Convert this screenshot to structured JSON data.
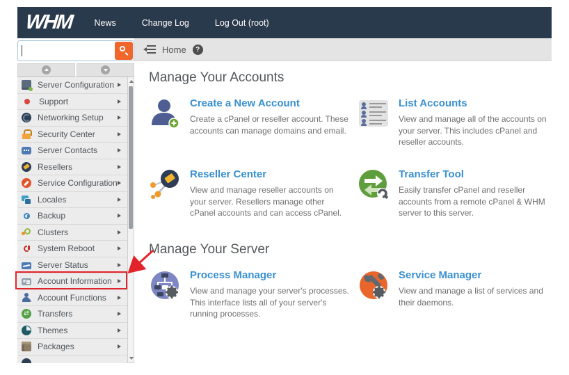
{
  "topbar": {
    "logo_text": "WHM",
    "links": [
      {
        "label": "News"
      },
      {
        "label": "Change Log"
      },
      {
        "label": "Log Out (root)"
      }
    ]
  },
  "search": {
    "value": "",
    "placeholder": "",
    "button_icon": "search-icon"
  },
  "breadcrumb": {
    "home": "Home",
    "icons": [
      "collapse-sidebar-icon",
      "help-icon"
    ]
  },
  "sidebar": {
    "items": [
      {
        "label": "Server Configuration",
        "icon": "server-configuration-icon"
      },
      {
        "label": "Support",
        "icon": "support-icon"
      },
      {
        "label": "Networking Setup",
        "icon": "networking-setup-icon"
      },
      {
        "label": "Security Center",
        "icon": "security-center-icon"
      },
      {
        "label": "Server Contacts",
        "icon": "server-contacts-icon"
      },
      {
        "label": "Resellers",
        "icon": "resellers-icon"
      },
      {
        "label": "Service Configuration",
        "icon": "service-configuration-icon"
      },
      {
        "label": "Locales",
        "icon": "locales-icon"
      },
      {
        "label": "Backup",
        "icon": "backup-icon"
      },
      {
        "label": "Clusters",
        "icon": "clusters-icon"
      },
      {
        "label": "System Reboot",
        "icon": "system-reboot-icon"
      },
      {
        "label": "Server Status",
        "icon": "server-status-icon"
      },
      {
        "label": "Account Information",
        "icon": "account-information-icon",
        "highlighted": true
      },
      {
        "label": "Account Functions",
        "icon": "account-functions-icon"
      },
      {
        "label": "Transfers",
        "icon": "transfers-icon"
      },
      {
        "label": "Themes",
        "icon": "themes-icon"
      },
      {
        "label": "Packages",
        "icon": "packages-icon"
      }
    ]
  },
  "main": {
    "sections": [
      {
        "title": "Manage Your Accounts",
        "cards": [
          {
            "title": "Create a New Account",
            "icon": "create-new-account-icon",
            "description": "Create a cPanel or reseller account. These accounts can manage domains and email."
          },
          {
            "title": "List Accounts",
            "icon": "list-accounts-icon",
            "description": "View and manage all of the accounts on your server. This includes cPanel and reseller accounts."
          },
          {
            "title": "Reseller Center",
            "icon": "reseller-center-icon",
            "description": "View and manage reseller accounts on your server. Resellers manage other cPanel accounts and can access cPanel."
          },
          {
            "title": "Transfer Tool",
            "icon": "transfer-tool-icon",
            "description": "Easily transfer cPanel and reseller accounts from a remote cPanel & WHM server to this server."
          }
        ]
      },
      {
        "title": "Manage Your Server",
        "cards": [
          {
            "title": "Process Manager",
            "icon": "process-manager-icon",
            "description": "View and manage your server's processes. This interface lists all of your server's running processes."
          },
          {
            "title": "Service Manager",
            "icon": "service-manager-icon",
            "description": "View and manage a list of services and their daemons."
          }
        ]
      }
    ]
  },
  "annotation": {
    "target": "Account Information",
    "color": "#e3232b"
  },
  "colors": {
    "topbar_bg": "#2a3a4d",
    "accent_orange": "#f1662b",
    "link_blue": "#3990d0",
    "sidebar_bg": "#ececec",
    "breadcrumb_bg": "#e4e4e4",
    "annotation_red": "#e3232b"
  }
}
